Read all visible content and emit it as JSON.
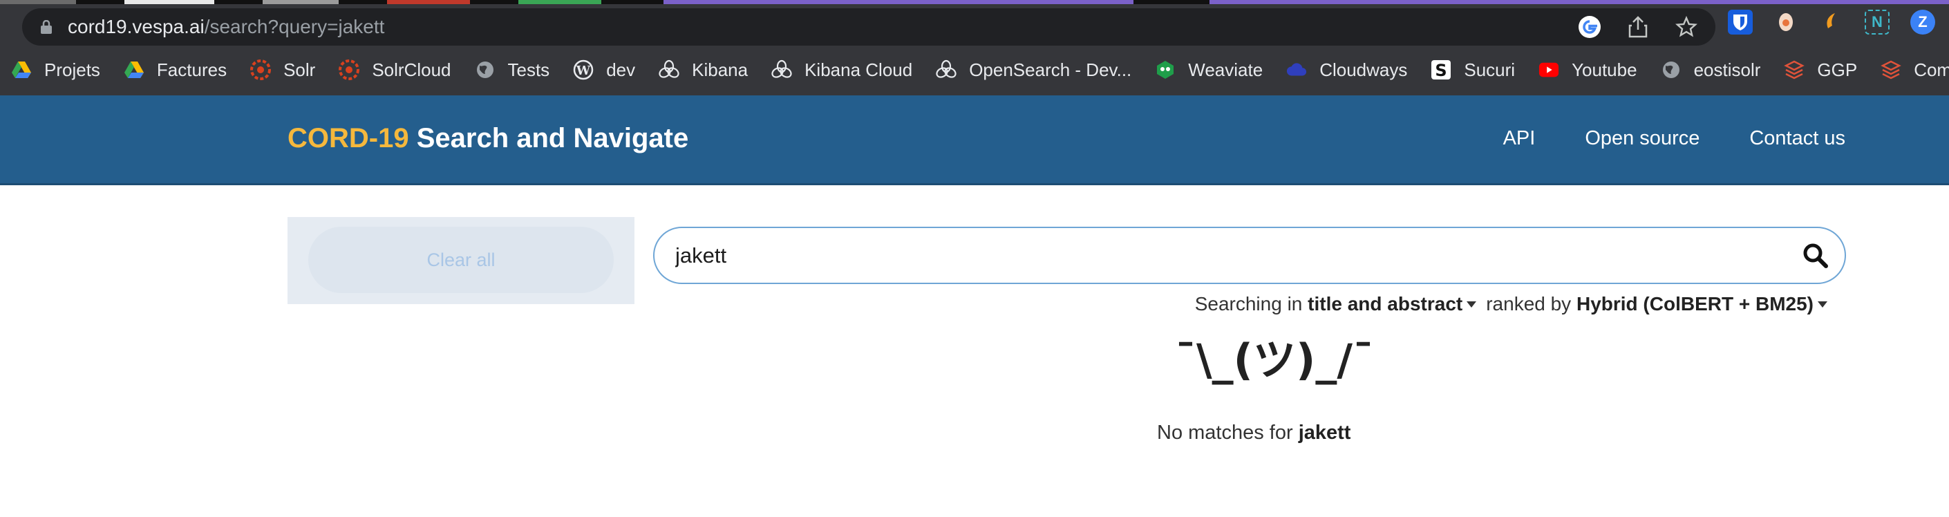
{
  "browser": {
    "url_host": "cord19.vespa.ai",
    "url_path": "/search?query=jakett",
    "bookmarks": [
      {
        "label": "Projets",
        "icon": "google-drive-icon"
      },
      {
        "label": "Factures",
        "icon": "google-drive-icon"
      },
      {
        "label": "Solr",
        "icon": "solr-icon"
      },
      {
        "label": "SolrCloud",
        "icon": "solr-icon"
      },
      {
        "label": "Tests",
        "icon": "globe-icon"
      },
      {
        "label": "dev",
        "icon": "wordpress-icon"
      },
      {
        "label": "Kibana",
        "icon": "openai-icon"
      },
      {
        "label": "Kibana Cloud",
        "icon": "openai-icon"
      },
      {
        "label": "OpenSearch - Dev...",
        "icon": "openai-icon"
      },
      {
        "label": "Weaviate",
        "icon": "weaviate-icon"
      },
      {
        "label": "Cloudways",
        "icon": "cloud-icon"
      },
      {
        "label": "Sucuri",
        "icon": "sucuri-icon"
      },
      {
        "label": "Youtube",
        "icon": "youtube-icon"
      },
      {
        "label": "eostisolr",
        "icon": "globe-icon"
      },
      {
        "label": "GGP",
        "icon": "layers-icon"
      },
      {
        "label": "Communi",
        "icon": "layers-icon"
      }
    ]
  },
  "header": {
    "brand_accent": "CORD-19",
    "brand_rest": " Search and Navigate",
    "nav": [
      "API",
      "Open source",
      "Contact us"
    ]
  },
  "sidebar": {
    "clear_all": "Clear all"
  },
  "search": {
    "query": "jakett"
  },
  "options": {
    "searching_in_prefix": "Searching in",
    "field": "title and abstract",
    "ranked_by_prefix": "ranked by",
    "ranking": "Hybrid (ColBERT + BM25)"
  },
  "results": {
    "shrug": "¯\\_(ツ)_/¯",
    "no_matches_prefix": "No matches for",
    "no_matches_query": "jakett"
  },
  "colors": {
    "header_bg": "#245e8d",
    "brand_accent": "#f5b83d",
    "chrome_bg": "#35363a"
  }
}
